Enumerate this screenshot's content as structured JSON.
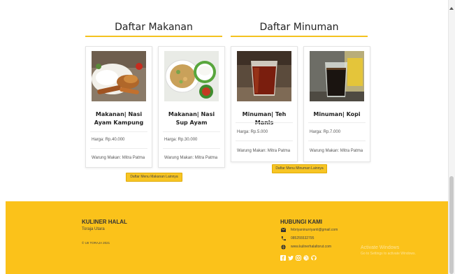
{
  "sections": {
    "food_title": "Daftar Makanan",
    "drink_title": "Daftar Minuman"
  },
  "cards": [
    {
      "name": "Makanan| Nasi Ayam Kampung",
      "price": "Harga: Rp.40.000",
      "shop": "Warung Makan: Mitra Patma",
      "image": "fried-chicken-rice-photo"
    },
    {
      "name": "Makanan| Nasi Sup Ayam",
      "price": "Harga: Rp.30.000",
      "shop": "Warung Makan: Mitra Patma",
      "image": "chicken-soup-rice-photo"
    },
    {
      "name": "Minuman| Teh Manis",
      "price": "Harga: Rp.5.000",
      "shop": "Warung Makan: Mitra Patma",
      "image": "sweet-tea-glass-photo"
    },
    {
      "name": "Minuman| Kopi",
      "price": "Harga: Rp.7.000",
      "shop": "Warung Makan: Mitra Patma",
      "image": "coffee-glass-photo"
    }
  ],
  "buttons": {
    "more_food": "Daftar Menu Makanan Lainnya",
    "more_drink": "Daftar Menu Minuman Lainnya"
  },
  "footer": {
    "brand": "KULINER HALAL",
    "city": "Toraja Utara",
    "copyright": "© UII TORAJA 2021",
    "contact_title": "HUBUNGI KAMI",
    "email": "febriyaninurriyanti@gmail.com",
    "phone": "085255532795",
    "website": "www.kulinerhalaltorut.com",
    "socials": [
      "facebook-icon",
      "twitter-icon",
      "instagram-icon",
      "dribbble-icon",
      "github-icon"
    ]
  },
  "watermark": {
    "line1": "Activate Windows",
    "line2": "Go to Settings to activate Windows."
  },
  "colors": {
    "accent": "#fbc21a",
    "button": "#f7c524"
  }
}
